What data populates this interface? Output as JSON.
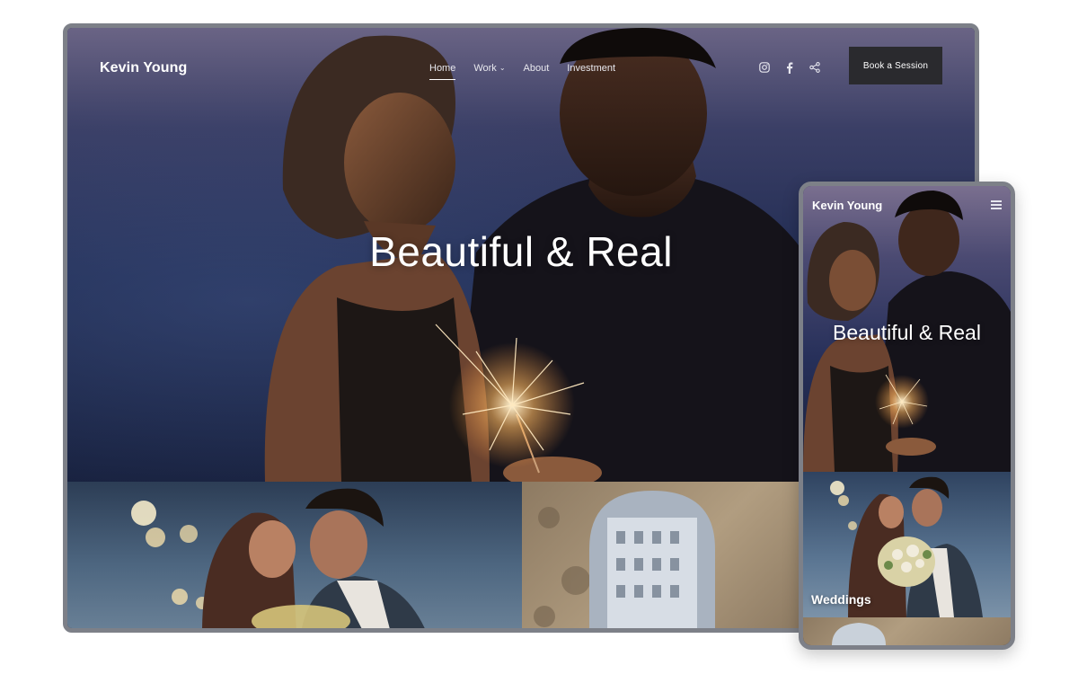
{
  "site": {
    "brand": "Kevin Young",
    "nav": [
      {
        "label": "Home",
        "active": true
      },
      {
        "label": "Work",
        "has_dropdown": true
      },
      {
        "label": "About"
      },
      {
        "label": "Investment"
      }
    ],
    "social_icons": [
      "instagram-icon",
      "facebook-icon",
      "share-icon"
    ],
    "cta_label": "Book a Session",
    "hero_title": "Beautiful & Real"
  },
  "mobile": {
    "brand": "Kevin Young",
    "menu_icon": "hamburger-menu-icon",
    "hero_title": "Beautiful & Real",
    "gallery_caption": "Weddings"
  },
  "colors": {
    "frame": "#7d8088",
    "cta_bg": "#2a2a2e",
    "text": "#ffffff"
  }
}
